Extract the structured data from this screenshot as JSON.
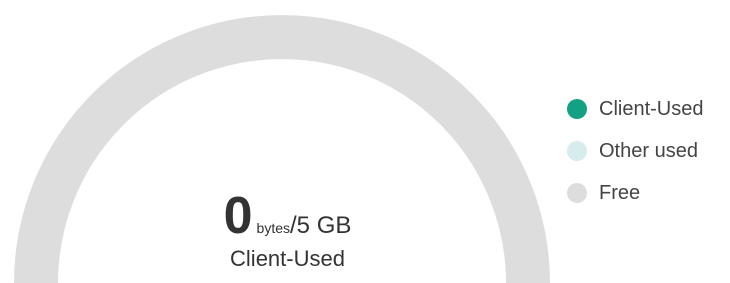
{
  "gauge": {
    "value": "0",
    "unit": "bytes",
    "total": "/5 GB",
    "caption": "Client-Used",
    "used_fraction": 0,
    "other_fraction": 0,
    "free_fraction": 1
  },
  "legend": {
    "items": [
      {
        "label": "Client-Used",
        "color": "#12a283"
      },
      {
        "label": "Other used",
        "color": "#d6eced"
      },
      {
        "label": "Free",
        "color": "#dddddd"
      }
    ]
  },
  "colors": {
    "track": "#dddddd",
    "used": "#12a283",
    "other": "#d6eced",
    "text": "#333333"
  }
}
